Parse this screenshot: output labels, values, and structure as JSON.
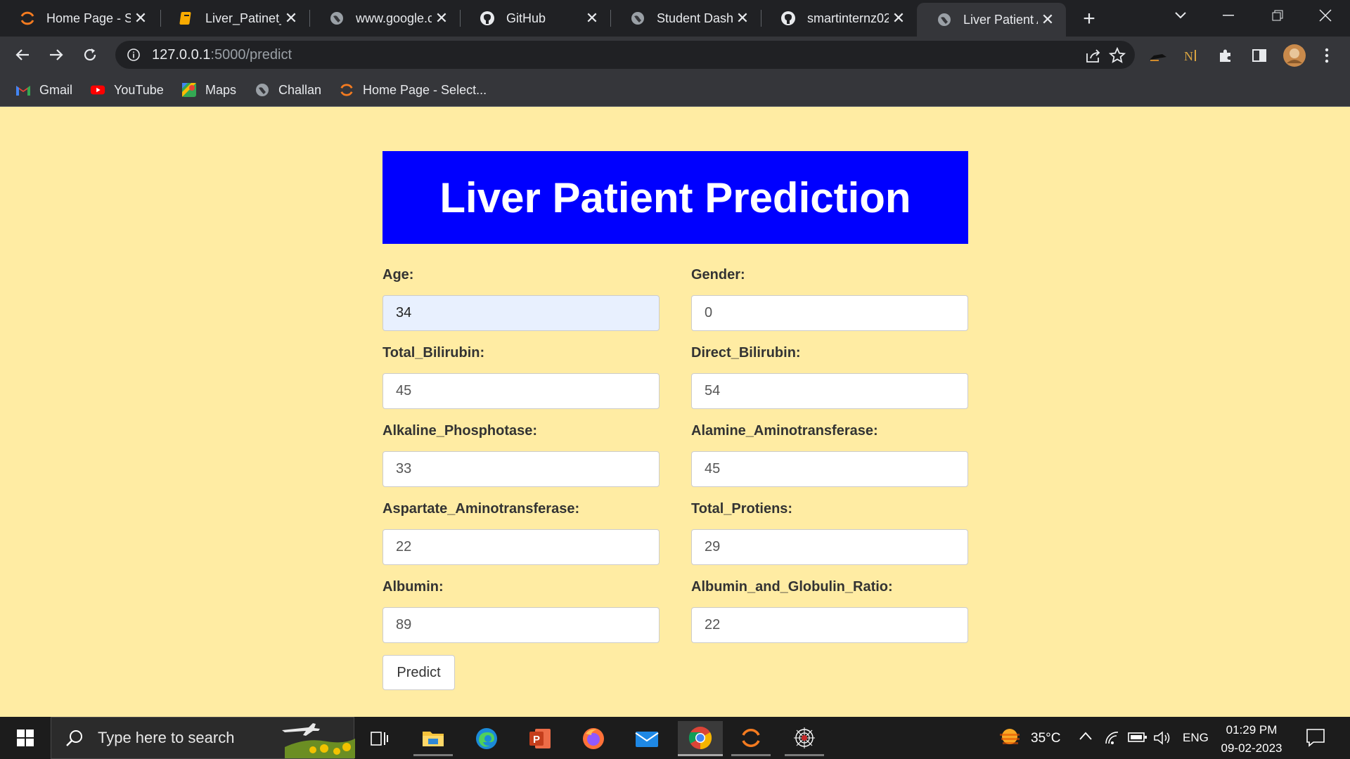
{
  "browser": {
    "tabs": [
      {
        "title": "Home Page - S",
        "icon": "smartbridge-logo-icon"
      },
      {
        "title": "Liver_Patinet_A",
        "icon": "notebook-icon"
      },
      {
        "title": "www.google.co",
        "icon": "globe-icon"
      },
      {
        "title": "GitHub",
        "icon": "github-icon"
      },
      {
        "title": "Student Dashb",
        "icon": "globe-icon"
      },
      {
        "title": "smartinternz02",
        "icon": "github-icon"
      },
      {
        "title": "Liver Patient An",
        "icon": "globe-icon",
        "active": true
      }
    ],
    "address": {
      "host": "127.0.0.1",
      "rest": ":5000/predict"
    },
    "bookmarks": [
      {
        "label": "Gmail",
        "icon": "gmail-icon"
      },
      {
        "label": "YouTube",
        "icon": "youtube-icon"
      },
      {
        "label": "Maps",
        "icon": "maps-icon"
      },
      {
        "label": "Challan",
        "icon": "globe-icon"
      },
      {
        "label": "Home Page - Select...",
        "icon": "smartbridge-logo-icon"
      }
    ]
  },
  "page": {
    "title": "Liver Patient Prediction",
    "fields": [
      {
        "label": "Age:",
        "value": "34"
      },
      {
        "label": "Gender:",
        "value": "0"
      },
      {
        "label": "Total_Bilirubin:",
        "value": "45"
      },
      {
        "label": "Direct_Bilirubin:",
        "value": "54"
      },
      {
        "label": "Alkaline_Phosphotase:",
        "value": "33"
      },
      {
        "label": "Alamine_Aminotransferase:",
        "value": "45"
      },
      {
        "label": "Aspartate_Aminotransferase:",
        "value": "22"
      },
      {
        "label": "Total_Protiens:",
        "value": "29"
      },
      {
        "label": "Albumin:",
        "value": "89"
      },
      {
        "label": "Albumin_and_Globulin_Ratio:",
        "value": "22"
      }
    ],
    "predict_label": "Predict"
  },
  "taskbar": {
    "search_placeholder": "Type here to search",
    "temperature": "35°C",
    "language": "ENG",
    "time": "01:29 PM",
    "date": "09-02-2023"
  },
  "colors": {
    "page_bg": "#ffeca3",
    "banner_bg": "#0000ff",
    "banner_text": "#ffffff"
  }
}
